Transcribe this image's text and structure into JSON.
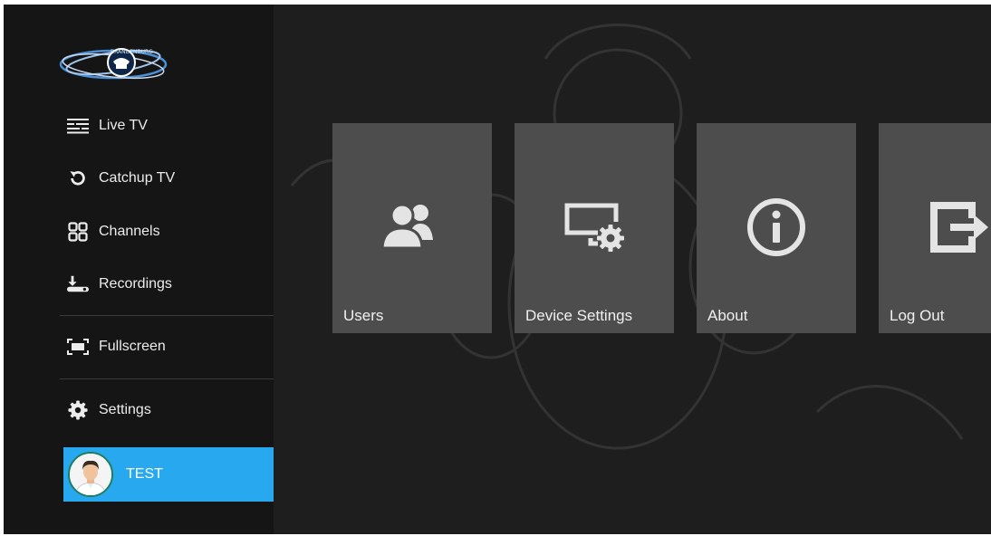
{
  "brand": {
    "logo_text": "BRANDENBURG"
  },
  "sidebar": {
    "items": [
      {
        "label": "Live TV",
        "icon": "live-tv-icon"
      },
      {
        "label": "Catchup TV",
        "icon": "catchup-icon"
      },
      {
        "label": "Channels",
        "icon": "channels-grid-icon"
      },
      {
        "label": "Recordings",
        "icon": "recordings-icon"
      },
      {
        "label": "Fullscreen",
        "icon": "fullscreen-icon"
      },
      {
        "label": "Settings",
        "icon": "gear-icon"
      }
    ],
    "user": {
      "name": "TEST",
      "icon": "avatar"
    }
  },
  "tiles": [
    {
      "label": "Users",
      "icon": "users-icon"
    },
    {
      "label": "Device Settings",
      "icon": "device-settings-icon"
    },
    {
      "label": "About",
      "icon": "info-icon"
    },
    {
      "label": "Log Out",
      "icon": "logout-icon"
    }
  ],
  "colors": {
    "accent": "#28a8ee",
    "tile": "#4d4d4d",
    "sidebar": "#151515",
    "background": "#1e1e1e"
  }
}
